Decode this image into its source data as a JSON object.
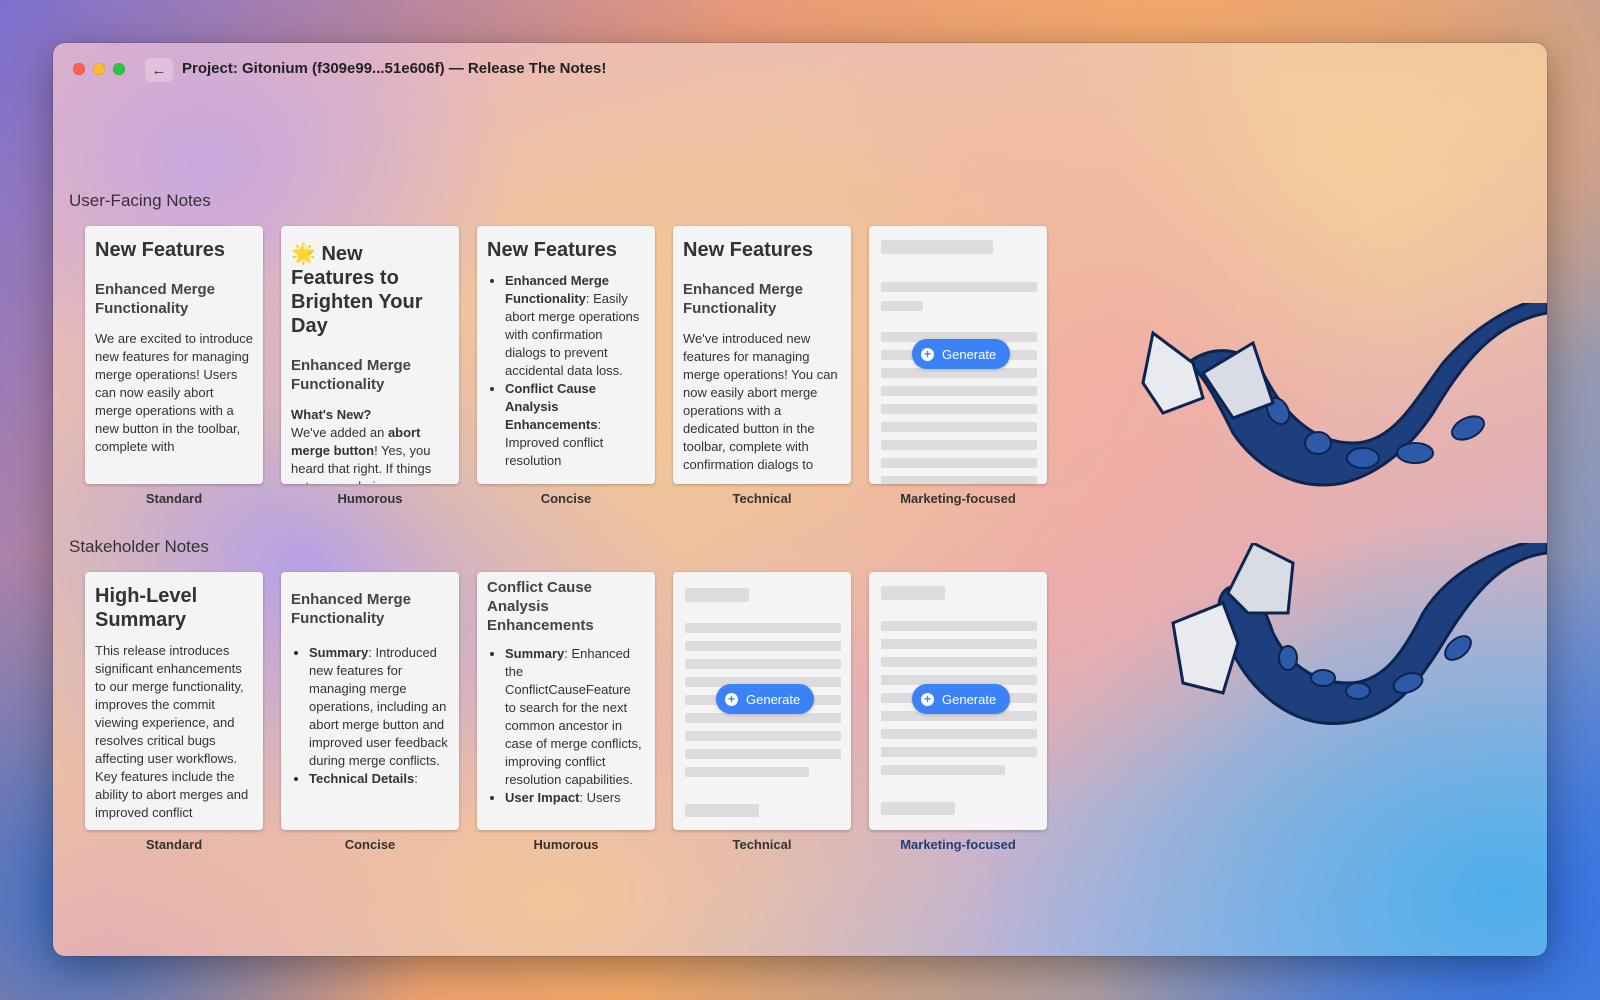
{
  "window": {
    "title": "Project: Gitonium (f309e99...51e606f) — Release The Notes!"
  },
  "sections": {
    "user_facing": {
      "title": "User-Facing Notes",
      "cards": [
        {
          "label": "Standard",
          "heading": "New Features",
          "subheading": "Enhanced Merge Functionality",
          "body": "We are excited to introduce new features for managing merge operations! Users can now easily abort merge operations with a new button in the toolbar, complete with"
        },
        {
          "label": "Humorous",
          "heading": "🌟 New Features to Brighten Your Day",
          "subheading": "Enhanced Merge Functionality",
          "whats_new": "What's New?",
          "body_pre": "We've added an ",
          "body_bold": "abort merge button",
          "body_post": "! Yes, you heard that right. If things get messy during a"
        },
        {
          "label": "Concise",
          "heading": "New Features",
          "b1_bold": "Enhanced Merge Functionality",
          "b1": ": Easily abort merge operations with confirmation dialogs to prevent accidental data loss.",
          "b2_bold": "Conflict Cause Analysis Enhancements",
          "b2": ": Improved conflict resolution"
        },
        {
          "label": "Technical",
          "heading": "New Features",
          "subheading": "Enhanced Merge Functionality",
          "body": "We've introduced new features for managing merge operations! You can now easily abort merge operations with a dedicated button in the toolbar, complete with confirmation dialogs to"
        },
        {
          "label": "Marketing-focused",
          "button": "Generate"
        }
      ]
    },
    "stakeholder": {
      "title": "Stakeholder Notes",
      "cards": [
        {
          "label": "Standard",
          "heading": "High-Level Summary",
          "body": "This release introduces significant enhancements to our merge functionality, improves the commit viewing experience, and resolves critical bugs affecting user workflows. Key features include the ability to abort merges and improved conflict"
        },
        {
          "label": "Concise",
          "subheading": "Enhanced Merge Functionality",
          "b1_bold": "Summary",
          "b1": ": Introduced new features for managing merge operations, including an abort merge button and improved user feedback during merge conflicts.",
          "b2_bold": "Technical Details",
          "b2": ":"
        },
        {
          "label": "Humorous",
          "subheading": "Conflict Cause Analysis Enhancements",
          "b1_bold": "Summary",
          "b1": ": Enhanced the ConflictCauseFeature to search for the next common ancestor in case of merge conflicts, improving conflict resolution capabilities.",
          "b2_bold": "User Impact",
          "b2": ": Users"
        },
        {
          "label": "Technical",
          "button": "Generate"
        },
        {
          "label": "Marketing-focused",
          "button": "Generate"
        }
      ]
    }
  },
  "icons": {
    "back": "arrow-left-icon",
    "generate": "plus-circle-icon",
    "decoration": "tentacle-illustration"
  },
  "colors": {
    "accent": "#3b82f6",
    "active_label": "#1f3e7a",
    "tentacle": "#1d3f7d"
  }
}
